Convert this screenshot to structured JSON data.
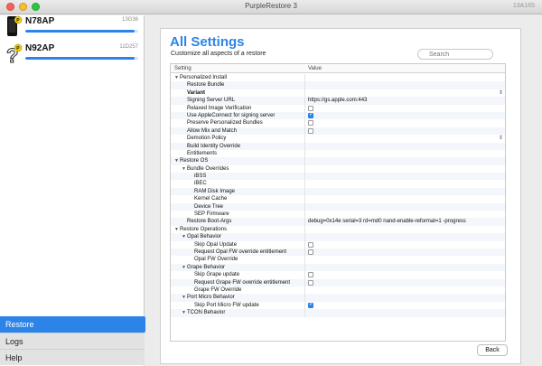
{
  "window": {
    "title": "PurpleRestore 3",
    "version": "13A165"
  },
  "devices": [
    {
      "name": "N78AP",
      "build": "13G36",
      "progress": 0.97,
      "icon": "iphone-icon"
    },
    {
      "name": "N92AP",
      "build": "11D257",
      "progress": 0.97,
      "icon": "unknown-device-icon"
    }
  ],
  "nav": [
    {
      "label": "Restore",
      "active": true
    },
    {
      "label": "Logs",
      "active": false
    },
    {
      "label": "Help",
      "active": false
    }
  ],
  "settings": {
    "title": "All Settings",
    "subtitle": "Customize all aspects of a restore",
    "search_placeholder": "Search",
    "col_setting": "Setting",
    "col_value": "Value",
    "back_label": "Back"
  },
  "rows": [
    {
      "label": "Personalized Install",
      "level": 0,
      "expander": true
    },
    {
      "label": "Restore Bundle",
      "level": 1
    },
    {
      "label": "Variant",
      "level": 1,
      "bold": true,
      "select": true
    },
    {
      "label": "Signing Server URL",
      "level": 1,
      "value": "https://gs.apple.com:443"
    },
    {
      "label": "Relaxed Image Verification",
      "level": 1,
      "checkbox": false
    },
    {
      "label": "Use AppleConnect for signing server",
      "level": 1,
      "checkbox": true
    },
    {
      "label": "Preserve Personalized Bundles",
      "level": 1,
      "checkbox": false
    },
    {
      "label": "Allow Mix and Match",
      "level": 1,
      "checkbox": false
    },
    {
      "label": "Demotion Policy",
      "level": 1,
      "select": true
    },
    {
      "label": "Build Identity Override",
      "level": 1
    },
    {
      "label": "Entitlements",
      "level": 1
    },
    {
      "label": "Restore OS",
      "level": 0,
      "expander": true
    },
    {
      "label": "Bundle Overrides",
      "level": 1,
      "expander": true
    },
    {
      "label": "iBSS",
      "level": 2
    },
    {
      "label": "iBEC",
      "level": 2
    },
    {
      "label": "RAM Disk Image",
      "level": 2
    },
    {
      "label": "Kernel Cache",
      "level": 2
    },
    {
      "label": "Device Tree",
      "level": 2
    },
    {
      "label": "SEP Firmware",
      "level": 2
    },
    {
      "label": "Restore Boot-Args",
      "level": 1,
      "value": "debug=0x14e serial=3 rd=md0 nand-enable-reformat=1 -progress"
    },
    {
      "label": "Restore Operations",
      "level": 0,
      "expander": true
    },
    {
      "label": "Opal Behavior",
      "level": 1,
      "expander": true
    },
    {
      "label": "Skip Opal Update",
      "level": 2,
      "checkbox": false
    },
    {
      "label": "Request Opal FW override entitlement",
      "level": 2,
      "checkbox": false
    },
    {
      "label": "Opal FW Override",
      "level": 2
    },
    {
      "label": "Grape Behavior",
      "level": 1,
      "expander": true
    },
    {
      "label": "Skip Grape update",
      "level": 2,
      "checkbox": false
    },
    {
      "label": "Request Grape FW override entitlement",
      "level": 2,
      "checkbox": false
    },
    {
      "label": "Grape FW Override",
      "level": 2
    },
    {
      "label": "Port Micro Behavior",
      "level": 1,
      "expander": true
    },
    {
      "label": "Skip Port Micro FW update",
      "level": 2,
      "checkbox": true
    },
    {
      "label": "TCON Behavior",
      "level": 1,
      "expander": true
    }
  ]
}
